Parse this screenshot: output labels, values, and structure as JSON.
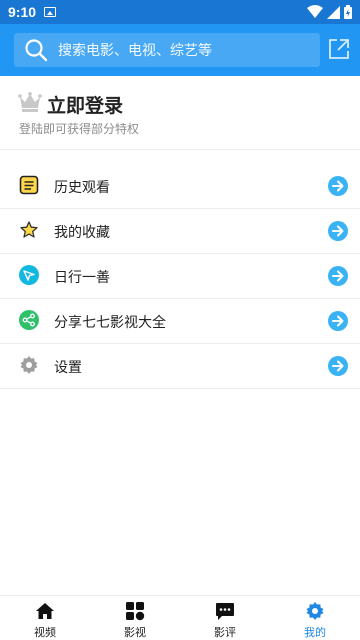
{
  "status_bar": {
    "time": "9:10"
  },
  "search": {
    "placeholder": "搜索电影、电视、综艺等"
  },
  "login": {
    "title": "立即登录",
    "subtitle": "登陆即可获得部分特权"
  },
  "menu": [
    {
      "label": "历史观看",
      "icon": "history-icon"
    },
    {
      "label": "我的收藏",
      "icon": "favorite-star-icon"
    },
    {
      "label": "日行一善",
      "icon": "good-deed-icon"
    },
    {
      "label": "分享七七影视大全",
      "icon": "share-icon"
    },
    {
      "label": "设置",
      "icon": "settings-gear-icon"
    }
  ],
  "bottom_nav": [
    {
      "label": "视频",
      "icon": "home-icon",
      "active": false
    },
    {
      "label": "影视",
      "icon": "grid-icon",
      "active": false
    },
    {
      "label": "影评",
      "icon": "comment-icon",
      "active": false
    },
    {
      "label": "我的",
      "icon": "settings-gear-icon",
      "active": true
    }
  ],
  "colors": {
    "primary": "#2196f3",
    "status_bar": "#1976d2",
    "accent": "#1e88e5",
    "arrow": "#3ab3f5"
  }
}
